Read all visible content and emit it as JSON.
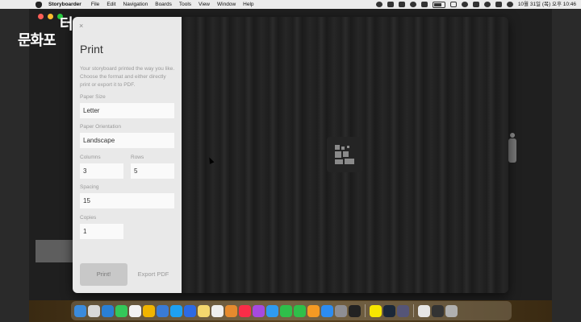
{
  "menubar": {
    "app": "Storyboarder",
    "items": [
      "File",
      "Edit",
      "Navigation",
      "Boards",
      "Tools",
      "View",
      "Window",
      "Help"
    ],
    "clock": "10월 31일 (목) 오후 10:46"
  },
  "watermark": {
    "line1": "터",
    "line2": "문화포"
  },
  "print": {
    "close": "×",
    "title": "Print",
    "description": "Your storyboard printed the way you like. Choose the format and either directly print or export it to PDF.",
    "paper_size_label": "Paper Size",
    "paper_size": "Letter",
    "orientation_label": "Paper Orientation",
    "orientation": "Landscape",
    "columns_label": "Columns",
    "columns": "3",
    "rows_label": "Rows",
    "rows": "5",
    "spacing_label": "Spacing",
    "spacing": "15",
    "copies_label": "Copies",
    "copies": "1",
    "print_button": "Print!",
    "export_button": "Export PDF"
  },
  "colors": {
    "sidebar": "#e9e9e9",
    "field": "#fafafa",
    "preview": "#1d1d1d"
  },
  "dock": {
    "icons": [
      {
        "name": "finder-icon",
        "color": "#3b8bdc"
      },
      {
        "name": "launchpad-icon",
        "color": "#d8d8d8"
      },
      {
        "name": "safari-icon",
        "color": "#2a7fd4"
      },
      {
        "name": "messages-icon",
        "color": "#34c759"
      },
      {
        "name": "calendar-icon",
        "color": "#f2f2f2"
      },
      {
        "name": "chrome-icon",
        "color": "#f0b400"
      },
      {
        "name": "mail-icon",
        "color": "#3a7bd5"
      },
      {
        "name": "twitter-icon",
        "color": "#1da1f2"
      },
      {
        "name": "zoom-icon",
        "color": "#2d6ae3"
      },
      {
        "name": "notes-icon",
        "color": "#f5d76e"
      },
      {
        "name": "reminders-icon",
        "color": "#eeeeee"
      },
      {
        "name": "photos-icon",
        "color": "#e68a2e"
      },
      {
        "name": "music-icon",
        "color": "#fa2d48"
      },
      {
        "name": "podcasts-icon",
        "color": "#a64ae0"
      },
      {
        "name": "keynote-icon",
        "color": "#2f9bf0"
      },
      {
        "name": "numbers-icon",
        "color": "#2fbf4a"
      },
      {
        "name": "facetime-icon",
        "color": "#2fbf4a"
      },
      {
        "name": "pages-icon",
        "color": "#f59a23"
      },
      {
        "name": "app-store-icon",
        "color": "#2d8cf0"
      },
      {
        "name": "system-preferences-icon",
        "color": "#8e8e93"
      },
      {
        "name": "epic-games-icon",
        "color": "#222222"
      },
      {
        "name": "kakaotalk-icon",
        "color": "#f7e600"
      },
      {
        "name": "steam-icon",
        "color": "#1b2838"
      },
      {
        "name": "storyboarder-icon",
        "color": "#555577"
      },
      {
        "name": "document-icon",
        "color": "#e6e6e6"
      },
      {
        "name": "stack-icon",
        "color": "#333333"
      },
      {
        "name": "trash-icon",
        "color": "#b0b0b0"
      }
    ]
  }
}
